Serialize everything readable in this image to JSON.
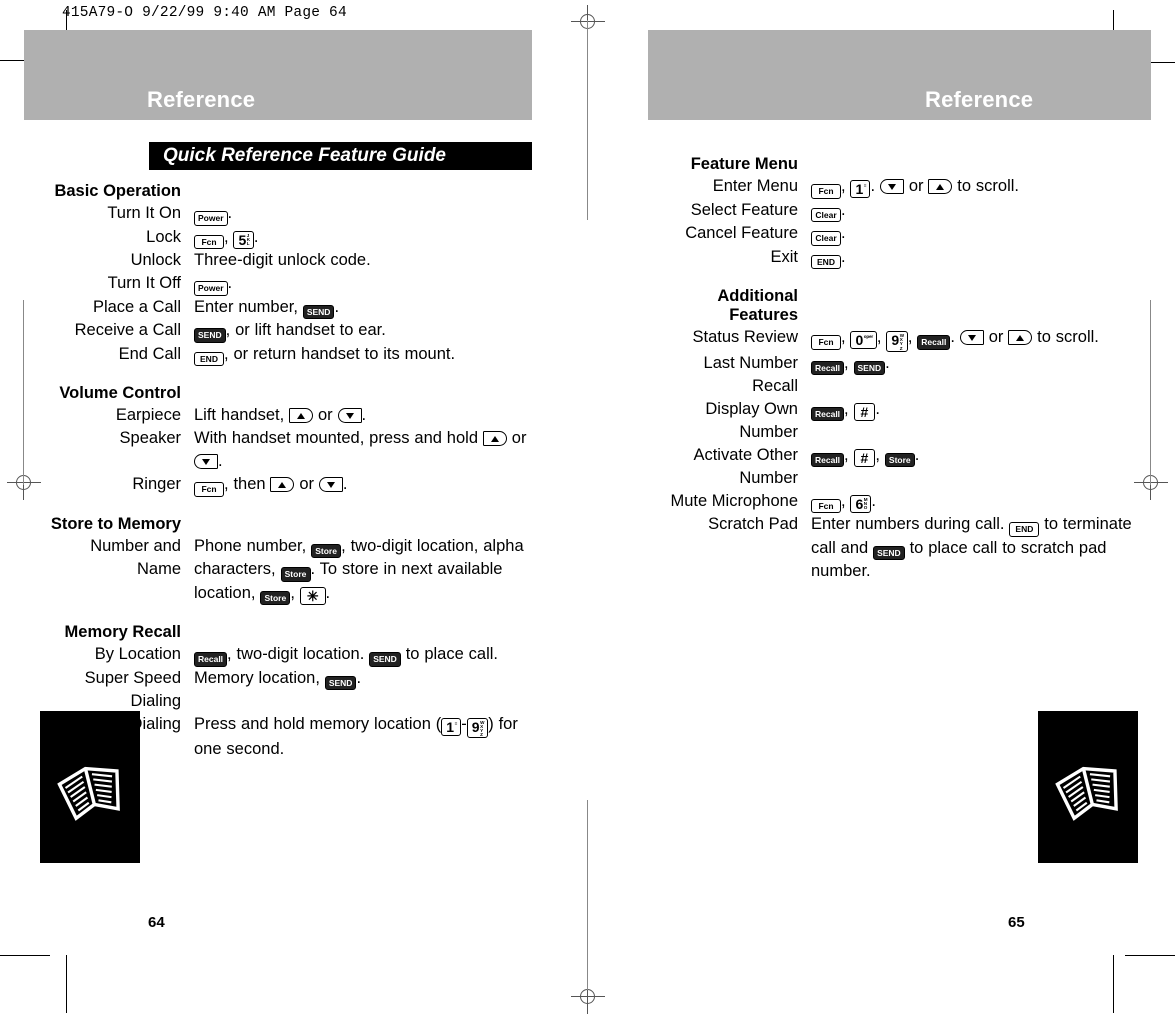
{
  "scan_header": "415A79-O  9/22/99 9:40 AM  Page 64",
  "pages": {
    "left": {
      "header_title": "Reference",
      "page_number": "64",
      "tab_icon": "open-book-icon"
    },
    "right": {
      "header_title": "Reference",
      "page_number": "65",
      "tab_icon": "open-book-icon"
    }
  },
  "section_title": "Quick Reference Feature Guide",
  "colors": {
    "header_bar": "#b0b0b0",
    "section_bar": "#000000",
    "section_text": "#ffffff",
    "page_background": "#ffffff",
    "body_text": "#000000"
  },
  "groups": [
    {
      "id": "basic-operation",
      "column": "left",
      "heading": "Basic Operation",
      "rows": [
        {
          "label": "Turn It On",
          "parts": [
            {
              "t": "key",
              "k": "Power",
              "style": "wide"
            },
            {
              "t": "text",
              "v": "."
            }
          ]
        },
        {
          "label": "Lock",
          "parts": [
            {
              "t": "key",
              "k": "Fcn",
              "style": "wide"
            },
            {
              "t": "text",
              "v": ", "
            },
            {
              "t": "numkey",
              "k": "5",
              "sub": "J\nK\nL"
            },
            {
              "t": "text",
              "v": "."
            }
          ]
        },
        {
          "label": "Unlock",
          "parts": [
            {
              "t": "text",
              "v": "Three-digit unlock code."
            }
          ]
        },
        {
          "label": "Turn It Off",
          "parts": [
            {
              "t": "key",
              "k": "Power",
              "style": "wide"
            },
            {
              "t": "text",
              "v": "."
            }
          ]
        },
        {
          "label": "Place a Call",
          "parts": [
            {
              "t": "text",
              "v": "Enter number, "
            },
            {
              "t": "key",
              "k": "SEND",
              "style": "dark"
            },
            {
              "t": "text",
              "v": "."
            }
          ]
        },
        {
          "label": "Receive a Call",
          "parts": [
            {
              "t": "key",
              "k": "SEND",
              "style": "dark"
            },
            {
              "t": "text",
              "v": ", or lift handset to ear."
            }
          ]
        },
        {
          "label": "End Call",
          "parts": [
            {
              "t": "key",
              "k": "END",
              "style": "wide"
            },
            {
              "t": "text",
              "v": ", or return handset to its mount."
            }
          ]
        }
      ]
    },
    {
      "id": "volume-control",
      "column": "left",
      "heading": "Volume Control",
      "rows": [
        {
          "label": "Earpiece",
          "parts": [
            {
              "t": "text",
              "v": "Lift handset, "
            },
            {
              "t": "arrow",
              "d": "up"
            },
            {
              "t": "text",
              "v": " or "
            },
            {
              "t": "arrow",
              "d": "down"
            },
            {
              "t": "text",
              "v": "."
            }
          ]
        },
        {
          "label": "Speaker",
          "parts": [
            {
              "t": "text",
              "v": "With handset mounted, press and hold "
            },
            {
              "t": "arrow",
              "d": "up"
            },
            {
              "t": "text",
              "v": " or "
            },
            {
              "t": "arrow",
              "d": "down"
            },
            {
              "t": "text",
              "v": "."
            }
          ]
        },
        {
          "label": "Ringer",
          "parts": [
            {
              "t": "key",
              "k": "Fcn",
              "style": "wide"
            },
            {
              "t": "text",
              "v": ", then "
            },
            {
              "t": "arrow",
              "d": "up"
            },
            {
              "t": "text",
              "v": " or "
            },
            {
              "t": "arrow",
              "d": "down"
            },
            {
              "t": "text",
              "v": "."
            }
          ]
        }
      ]
    },
    {
      "id": "store-to-memory",
      "column": "left",
      "heading": "Store to Memory",
      "rows": [
        {
          "label": "Number and\nName",
          "parts": [
            {
              "t": "text",
              "v": "Phone number, "
            },
            {
              "t": "key",
              "k": "Store",
              "style": "dark"
            },
            {
              "t": "text",
              "v": ", two-digit location, alpha characters, "
            },
            {
              "t": "key",
              "k": "Store",
              "style": "dark"
            },
            {
              "t": "text",
              "v": ". To store in next available location, "
            },
            {
              "t": "key",
              "k": "Store",
              "style": "dark"
            },
            {
              "t": "text",
              "v": ", "
            },
            {
              "t": "symkey",
              "k": "✳"
            },
            {
              "t": "text",
              "v": "."
            }
          ]
        }
      ]
    },
    {
      "id": "memory-recall",
      "column": "left",
      "heading": "Memory Recall",
      "rows": [
        {
          "label": "By Location",
          "parts": [
            {
              "t": "key",
              "k": "Recall",
              "style": "dark"
            },
            {
              "t": "text",
              "v": ", two-digit location. "
            },
            {
              "t": "key",
              "k": "SEND",
              "style": "dark"
            },
            {
              "t": "text",
              "v": " to place call."
            }
          ]
        },
        {
          "label": "Super Speed\nDialing",
          "parts": [
            {
              "t": "text",
              "v": "Memory location, "
            },
            {
              "t": "key",
              "k": "SEND",
              "style": "dark"
            },
            {
              "t": "text",
              "v": "."
            }
          ]
        },
        {
          "label": "Turbo Dialing",
          "parts": [
            {
              "t": "text",
              "v": "Press and hold memory location ("
            },
            {
              "t": "numkey",
              "k": "1",
              "sub": "≡"
            },
            {
              "t": "text",
              "v": "-"
            },
            {
              "t": "numkey",
              "k": "9",
              "sub": "W\nX\nY\nZ"
            },
            {
              "t": "text",
              "v": ") for one second."
            }
          ]
        }
      ]
    },
    {
      "id": "feature-menu",
      "column": "right",
      "heading": "Feature Menu",
      "rows": [
        {
          "label": "Enter Menu",
          "parts": [
            {
              "t": "key",
              "k": "Fcn",
              "style": "wide"
            },
            {
              "t": "text",
              "v": ", "
            },
            {
              "t": "numkey",
              "k": "1",
              "sub": "≡"
            },
            {
              "t": "text",
              "v": ". "
            },
            {
              "t": "arrow",
              "d": "down"
            },
            {
              "t": "text",
              "v": " or "
            },
            {
              "t": "arrow",
              "d": "up"
            },
            {
              "t": "text",
              "v": " to scroll."
            }
          ]
        },
        {
          "label": "Select Feature",
          "parts": [
            {
              "t": "key",
              "k": "Clear",
              "style": "wide"
            },
            {
              "t": "text",
              "v": "."
            }
          ]
        },
        {
          "label": "Cancel Feature",
          "parts": [
            {
              "t": "key",
              "k": "Clear",
              "style": "wide"
            },
            {
              "t": "text",
              "v": "."
            }
          ]
        },
        {
          "label": "Exit",
          "parts": [
            {
              "t": "key",
              "k": "END",
              "style": "wide"
            },
            {
              "t": "text",
              "v": "."
            }
          ]
        }
      ]
    },
    {
      "id": "additional-features",
      "column": "right",
      "heading": "Additional\nFeatures",
      "rows": [
        {
          "label": "Status Review",
          "parts": [
            {
              "t": "key",
              "k": "Fcn",
              "style": "wide"
            },
            {
              "t": "text",
              "v": ", "
            },
            {
              "t": "numkey",
              "k": "0",
              "sub": "oper"
            },
            {
              "t": "text",
              "v": ", "
            },
            {
              "t": "numkey",
              "k": "9",
              "sub": "W\nX\nY\nZ"
            },
            {
              "t": "text",
              "v": ", "
            },
            {
              "t": "key",
              "k": "Recall",
              "style": "dark"
            },
            {
              "t": "text",
              "v": ". "
            },
            {
              "t": "arrow",
              "d": "down"
            },
            {
              "t": "text",
              "v": " or "
            },
            {
              "t": "arrow",
              "d": "up"
            },
            {
              "t": "text",
              "v": " to scroll."
            }
          ]
        },
        {
          "label": "Last Number\nRecall",
          "parts": [
            {
              "t": "key",
              "k": "Recall",
              "style": "dark"
            },
            {
              "t": "text",
              "v": ", "
            },
            {
              "t": "key",
              "k": "SEND",
              "style": "dark"
            },
            {
              "t": "text",
              "v": "."
            }
          ]
        },
        {
          "label": "Display Own\nNumber",
          "parts": [
            {
              "t": "key",
              "k": "Recall",
              "style": "dark"
            },
            {
              "t": "text",
              "v": ", "
            },
            {
              "t": "symkey",
              "k": "#"
            },
            {
              "t": "text",
              "v": "."
            }
          ]
        },
        {
          "label": "Activate Other\nNumber",
          "parts": [
            {
              "t": "key",
              "k": "Recall",
              "style": "dark"
            },
            {
              "t": "text",
              "v": ", "
            },
            {
              "t": "symkey",
              "k": "#"
            },
            {
              "t": "text",
              "v": ", "
            },
            {
              "t": "key",
              "k": "Store",
              "style": "dark"
            },
            {
              "t": "text",
              "v": "."
            }
          ]
        },
        {
          "label": "Mute Microphone",
          "parts": [
            {
              "t": "key",
              "k": "Fcn",
              "style": "wide"
            },
            {
              "t": "text",
              "v": ", "
            },
            {
              "t": "numkey",
              "k": "6",
              "sub": "M\nN\nO"
            },
            {
              "t": "text",
              "v": "."
            }
          ]
        },
        {
          "label": "Scratch Pad",
          "parts": [
            {
              "t": "text",
              "v": "Enter numbers during call. "
            },
            {
              "t": "key",
              "k": "END",
              "style": "wide"
            },
            {
              "t": "text",
              "v": " to terminate call and "
            },
            {
              "t": "key",
              "k": "SEND",
              "style": "dark"
            },
            {
              "t": "text",
              "v": " to place call to scratch pad number."
            }
          ]
        }
      ]
    }
  ]
}
